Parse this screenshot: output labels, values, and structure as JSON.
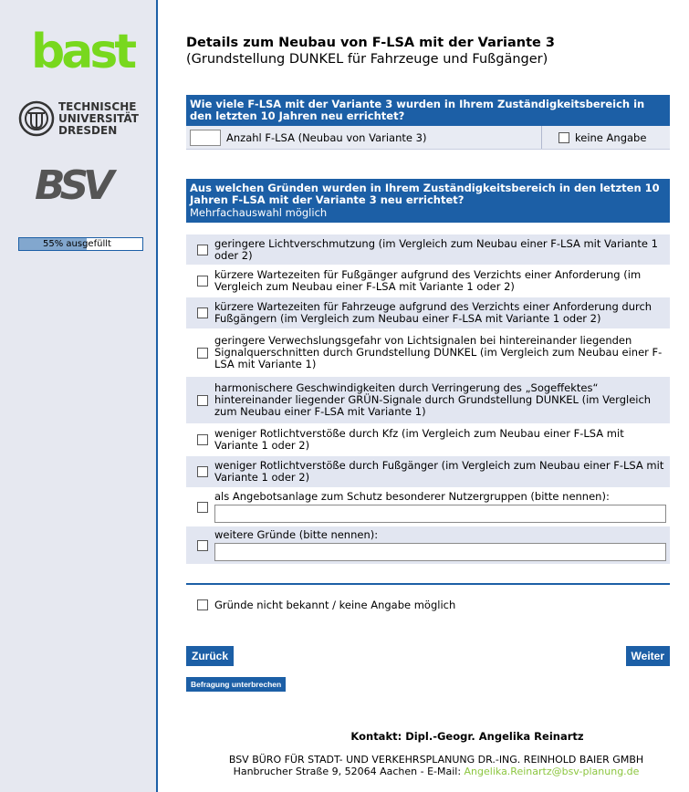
{
  "sidebar": {
    "logo_bast": "bast",
    "logo_tud_lines": [
      "TECHNISCHE",
      "UNIVERSITÄT",
      "DRESDEN"
    ],
    "logo_bsv": "BSV",
    "progress": {
      "label": "55% ausgefüllt",
      "value": 0.55
    }
  },
  "header": {
    "title": "Details zum Neubau von F-LSA mit der Variante 3",
    "subtitle": "(Grundstellung DUNKEL für Fahrzeuge und Fußgänger)"
  },
  "question1": {
    "text": "Wie viele F-LSA mit der Variante 3 wurden in Ihrem Zuständigkeitsbereich in den letzten 10 Jahren neu errichtet?",
    "input_value": "",
    "input_label": "Anzahl F-LSA (Neubau von Variante 3)",
    "no_answer_label": "keine Angabe"
  },
  "question2": {
    "text": "Aus welchen Gründen wurden in Ihrem Zuständigkeitsbereich in den letzten 10 Jahren F-LSA mit der Variante 3 neu errichtet?",
    "hint": "Mehrfachauswahl möglich",
    "options": [
      {
        "label": "geringere Lichtverschmutzung (im Vergleich zum Neubau einer F-LSA mit Variante 1 oder 2)"
      },
      {
        "label": "kürzere Wartezeiten für Fußgänger aufgrund des Verzichts einer Anforderung (im Vergleich zum Neubau einer F-LSA mit Variante 1 oder 2)"
      },
      {
        "label": "kürzere Wartezeiten für Fahrzeuge aufgrund des Verzichts einer Anforderung durch Fußgängern (im Vergleich zum Neubau einer F-LSA mit Variante 1 oder 2)"
      },
      {
        "label": "geringere Verwechslungsgefahr von Lichtsignalen bei hintereinander liegenden Signalquerschnitten durch Grundstellung DUNKEL (im Vergleich zum Neubau einer F-LSA mit Variante 1)"
      },
      {
        "label": "harmonischere Geschwindigkeiten durch Verringerung des „Sogeffektes“ hintereinander liegender GRÜN-Signale durch Grundstellung DUNKEL (im Vergleich zum Neubau einer F-LSA mit Variante 1)"
      },
      {
        "label": "weniger Rotlichtverstöße durch Kfz (im Vergleich zum Neubau einer F-LSA mit Variante 1 oder 2)"
      },
      {
        "label": "weniger Rotlichtverstöße durch Fußgänger (im Vergleich zum Neubau einer F-LSA mit Variante 1 oder 2)"
      },
      {
        "label": "als Angebotsanlage zum Schutz besonderer Nutzergruppen (bitte nennen):",
        "text_value": ""
      },
      {
        "label": "weitere Gründe (bitte nennen):",
        "text_value": ""
      }
    ],
    "unknown_label": "Gründe nicht bekannt / keine Angabe möglich"
  },
  "nav": {
    "back_label": "Zurück",
    "next_label": "Weiter",
    "pause_label": "Befragung unterbrechen"
  },
  "footer": {
    "contact": "Kontakt: Dipl.-Geogr. Angelika Reinartz",
    "company": "BSV BÜRO FÜR STADT- UND VERKEHRSPLANUNG DR.-ING. REINHOLD BAIER GMBH",
    "address": "Hanbrucher Straße 9, 52064 Aachen - E-Mail: ",
    "email": "Angelika.Reinartz@bsv-planung.de"
  },
  "colors": {
    "primary": "#1c5fa6",
    "sidebar_bg": "#e6e8f0",
    "row_alt": "#e2e6f1",
    "bast_green": "#78d81e",
    "link_green": "#8cc63f"
  }
}
